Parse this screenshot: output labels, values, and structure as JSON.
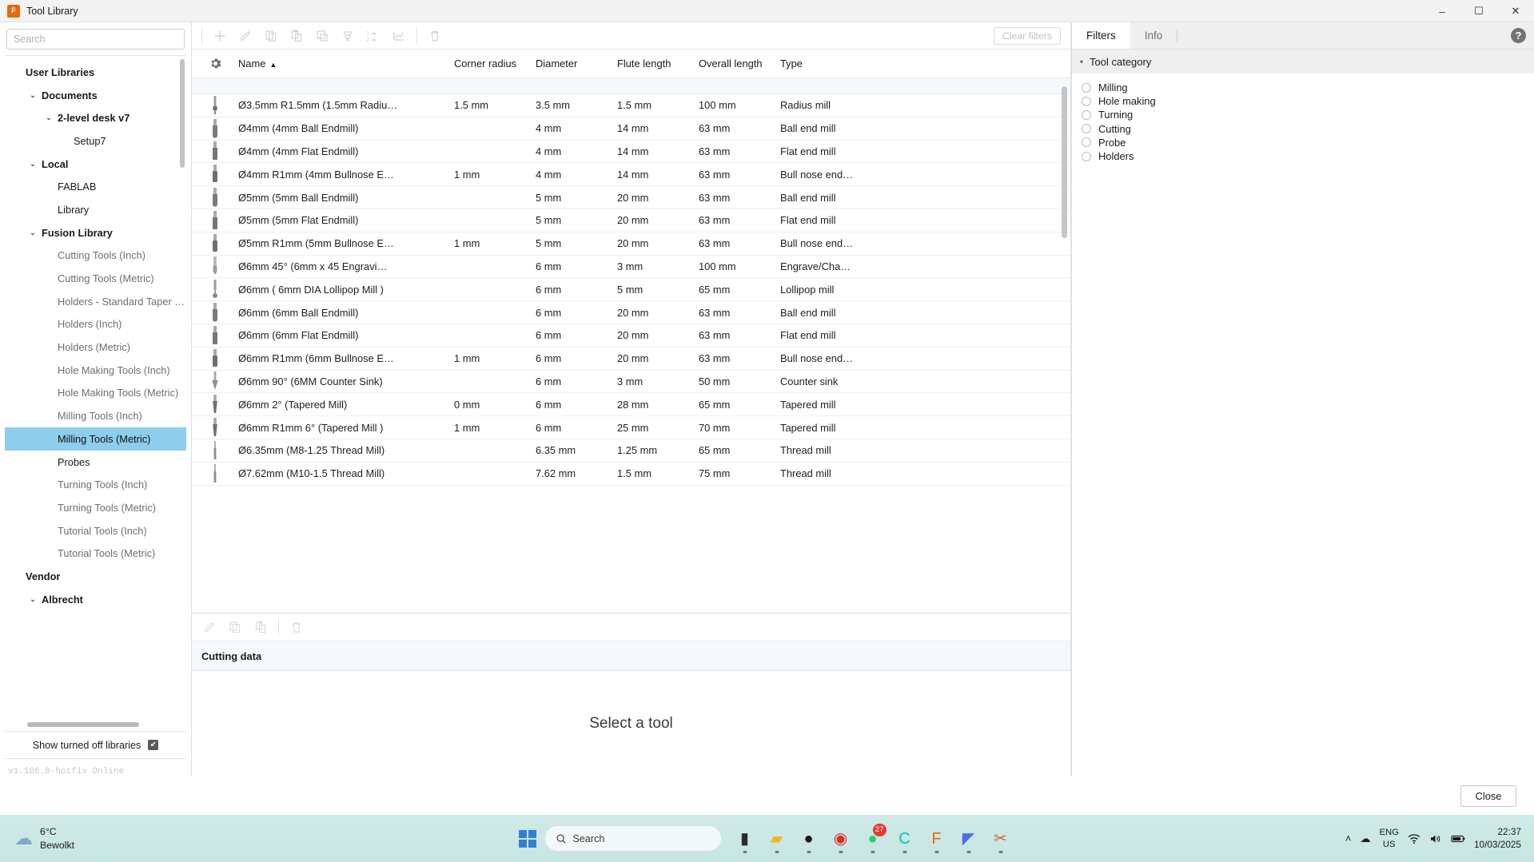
{
  "window": {
    "title": "Tool Library",
    "app_icon": "fusion-icon",
    "minimize": "–",
    "maximize": "☐",
    "close": "✕"
  },
  "sidebar": {
    "search_placeholder": "Search",
    "tree": [
      {
        "label": "User Libraries",
        "indent": 0,
        "style": "group",
        "twisty": ""
      },
      {
        "label": "Documents",
        "indent": 1,
        "style": "bold-item",
        "twisty": "⌄"
      },
      {
        "label": "2-level desk v7",
        "indent": 2,
        "style": "bold-item",
        "twisty": "⌄"
      },
      {
        "label": "Setup7",
        "indent": 3,
        "style": "normal",
        "twisty": ""
      },
      {
        "label": "Local",
        "indent": 1,
        "style": "bold-item",
        "twisty": "⌄"
      },
      {
        "label": "FABLAB",
        "indent": 2,
        "style": "normal",
        "twisty": ""
      },
      {
        "label": "Library",
        "indent": 2,
        "style": "normal",
        "twisty": ""
      },
      {
        "label": "Fusion Library",
        "indent": 1,
        "style": "bold-item",
        "twisty": "⌄"
      },
      {
        "label": "Cutting Tools (Inch)",
        "indent": 2,
        "style": "muted",
        "twisty": ""
      },
      {
        "label": "Cutting Tools (Metric)",
        "indent": 2,
        "style": "muted",
        "twisty": ""
      },
      {
        "label": "Holders - Standard Taper Blank",
        "indent": 2,
        "style": "muted",
        "twisty": ""
      },
      {
        "label": "Holders (Inch)",
        "indent": 2,
        "style": "muted",
        "twisty": ""
      },
      {
        "label": "Holders (Metric)",
        "indent": 2,
        "style": "muted",
        "twisty": ""
      },
      {
        "label": "Hole Making Tools (Inch)",
        "indent": 2,
        "style": "muted",
        "twisty": ""
      },
      {
        "label": "Hole Making Tools (Metric)",
        "indent": 2,
        "style": "muted",
        "twisty": ""
      },
      {
        "label": "Milling Tools (Inch)",
        "indent": 2,
        "style": "muted",
        "twisty": ""
      },
      {
        "label": "Milling Tools (Metric)",
        "indent": 2,
        "style": "selected",
        "twisty": ""
      },
      {
        "label": "Probes",
        "indent": 2,
        "style": "normal",
        "twisty": ""
      },
      {
        "label": "Turning Tools (Inch)",
        "indent": 2,
        "style": "muted",
        "twisty": ""
      },
      {
        "label": "Turning Tools (Metric)",
        "indent": 2,
        "style": "muted",
        "twisty": ""
      },
      {
        "label": "Tutorial Tools (Inch)",
        "indent": 2,
        "style": "muted",
        "twisty": ""
      },
      {
        "label": "Tutorial Tools (Metric)",
        "indent": 2,
        "style": "muted",
        "twisty": ""
      },
      {
        "label": "Vendor",
        "indent": 0,
        "style": "group",
        "twisty": ""
      },
      {
        "label": "Albrecht",
        "indent": 1,
        "style": "bold-item",
        "twisty": "⌄"
      }
    ],
    "show_turned_off_label": "Show turned off libraries",
    "show_turned_off_checked": true,
    "checkmark": "✔",
    "version": "v1.106.8-hotfix Online"
  },
  "toolbar": {
    "buttons": [
      {
        "name": "new-tool-button",
        "icon": "plus-icon"
      },
      {
        "name": "edit-tool-button",
        "icon": "pencil-icon"
      },
      {
        "name": "copy-tool-button",
        "icon": "copy-icon"
      },
      {
        "name": "paste-tool-button",
        "icon": "paste-icon"
      },
      {
        "name": "duplicate-tool-button",
        "icon": "duplicate-icon"
      },
      {
        "name": "holder-button",
        "icon": "holder-icon"
      },
      {
        "name": "renumber-button",
        "icon": "renumber-icon"
      },
      {
        "name": "cutting-data-button",
        "icon": "chart-icon"
      },
      {
        "name": "delete-tool-button",
        "icon": "trash-icon"
      }
    ],
    "clear_filters_label": "Clear filters"
  },
  "table": {
    "gear_icon": "gear-icon",
    "columns": [
      {
        "key": "name",
        "label": "Name",
        "sorted": true,
        "sort_caret": "▲"
      },
      {
        "key": "corner_radius",
        "label": "Corner radius"
      },
      {
        "key": "diameter",
        "label": "Diameter"
      },
      {
        "key": "flute_length",
        "label": "Flute length"
      },
      {
        "key": "overall_length",
        "label": "Overall length"
      },
      {
        "key": "type",
        "label": "Type"
      }
    ],
    "rows": [
      {
        "icon": "radius-mill-icon",
        "name": "Ø3.5mm R1.5mm (1.5mm Radiu…",
        "corner_radius": "1.5 mm",
        "diameter": "3.5 mm",
        "flute_length": "1.5 mm",
        "overall_length": "100 mm",
        "type": "Radius mill"
      },
      {
        "icon": "ball-endmill-icon",
        "name": "Ø4mm (4mm Ball Endmill)",
        "corner_radius": "",
        "diameter": "4 mm",
        "flute_length": "14 mm",
        "overall_length": "63 mm",
        "type": "Ball end mill"
      },
      {
        "icon": "flat-endmill-icon",
        "name": "Ø4mm (4mm Flat Endmill)",
        "corner_radius": "",
        "diameter": "4 mm",
        "flute_length": "14 mm",
        "overall_length": "63 mm",
        "type": "Flat end mill"
      },
      {
        "icon": "bullnose-endmill-icon",
        "name": "Ø4mm R1mm (4mm Bullnose E…",
        "corner_radius": "1 mm",
        "diameter": "4 mm",
        "flute_length": "14 mm",
        "overall_length": "63 mm",
        "type": "Bull nose end…"
      },
      {
        "icon": "ball-endmill-icon",
        "name": "Ø5mm (5mm Ball Endmill)",
        "corner_radius": "",
        "diameter": "5 mm",
        "flute_length": "20 mm",
        "overall_length": "63 mm",
        "type": "Ball end mill"
      },
      {
        "icon": "flat-endmill-icon",
        "name": "Ø5mm (5mm Flat Endmill)",
        "corner_radius": "",
        "diameter": "5 mm",
        "flute_length": "20 mm",
        "overall_length": "63 mm",
        "type": "Flat end mill"
      },
      {
        "icon": "bullnose-endmill-icon",
        "name": "Ø5mm R1mm (5mm Bullnose E…",
        "corner_radius": "1 mm",
        "diameter": "5 mm",
        "flute_length": "20 mm",
        "overall_length": "63 mm",
        "type": "Bull nose end…"
      },
      {
        "icon": "engrave-mill-icon",
        "name": "Ø6mm 45° (6mm x 45 Engravi…",
        "corner_radius": "",
        "diameter": "6 mm",
        "flute_length": "3 mm",
        "overall_length": "100 mm",
        "type": "Engrave/Cha…"
      },
      {
        "icon": "lollipop-mill-icon",
        "name": "Ø6mm ( 6mm DIA Lollipop Mill )",
        "corner_radius": "",
        "diameter": "6 mm",
        "flute_length": "5 mm",
        "overall_length": "65 mm",
        "type": "Lollipop mill"
      },
      {
        "icon": "ball-endmill-icon",
        "name": "Ø6mm (6mm Ball Endmill)",
        "corner_radius": "",
        "diameter": "6 mm",
        "flute_length": "20 mm",
        "overall_length": "63 mm",
        "type": "Ball end mill"
      },
      {
        "icon": "flat-endmill-icon",
        "name": "Ø6mm (6mm Flat Endmill)",
        "corner_radius": "",
        "diameter": "6 mm",
        "flute_length": "20 mm",
        "overall_length": "63 mm",
        "type": "Flat end mill"
      },
      {
        "icon": "bullnose-endmill-icon",
        "name": "Ø6mm R1mm (6mm Bullnose E…",
        "corner_radius": "1 mm",
        "diameter": "6 mm",
        "flute_length": "20 mm",
        "overall_length": "63 mm",
        "type": "Bull nose end…"
      },
      {
        "icon": "counter-sink-icon",
        "name": "Ø6mm 90° (6MM Counter Sink)",
        "corner_radius": "",
        "diameter": "6 mm",
        "flute_length": "3 mm",
        "overall_length": "50 mm",
        "type": "Counter sink"
      },
      {
        "icon": "tapered-mill-icon",
        "name": "Ø6mm 2° (Tapered Mill)",
        "corner_radius": "0 mm",
        "diameter": "6 mm",
        "flute_length": "28 mm",
        "overall_length": "65 mm",
        "type": "Tapered mill"
      },
      {
        "icon": "tapered-mill-icon",
        "name": "Ø6mm R1mm 6° (Tapered Mill )",
        "corner_radius": "1 mm",
        "diameter": "6 mm",
        "flute_length": "25 mm",
        "overall_length": "70 mm",
        "type": "Tapered mill"
      },
      {
        "icon": "thread-mill-icon",
        "name": "Ø6.35mm (M8-1.25 Thread Mill)",
        "corner_radius": "",
        "diameter": "6.35 mm",
        "flute_length": "1.25 mm",
        "overall_length": "65 mm",
        "type": "Thread mill"
      },
      {
        "icon": "thread-mill-icon",
        "name": "Ø7.62mm (M10-1.5 Thread Mill)",
        "corner_radius": "",
        "diameter": "7.62 mm",
        "flute_length": "1.5 mm",
        "overall_length": "75 mm",
        "type": "Thread mill"
      }
    ]
  },
  "bottom_pane": {
    "buttons": [
      {
        "name": "edit-cutting-data-button",
        "icon": "pencil-icon"
      },
      {
        "name": "copy-cutting-data-button",
        "icon": "copy-icon"
      },
      {
        "name": "paste-cutting-data-button",
        "icon": "paste-icon"
      },
      {
        "name": "delete-cutting-data-button",
        "icon": "trash-icon"
      }
    ],
    "tab_label": "Cutting data",
    "empty_message": "Select a tool"
  },
  "right_panel": {
    "tabs": [
      {
        "label": "Filters",
        "active": true
      },
      {
        "label": "Info",
        "active": false
      }
    ],
    "help_icon": "help-icon",
    "help_glyph": "?",
    "section": {
      "caret": "▾",
      "title": "Tool category",
      "options": [
        {
          "label": "Milling",
          "selected": false
        },
        {
          "label": "Hole making",
          "selected": false
        },
        {
          "label": "Turning",
          "selected": false
        },
        {
          "label": "Cutting",
          "selected": false
        },
        {
          "label": "Probe",
          "selected": false
        },
        {
          "label": "Holders",
          "selected": false
        }
      ]
    }
  },
  "footer": {
    "close_label": "Close"
  },
  "taskbar": {
    "weather_temp": "6°C",
    "weather_desc": "Bewolkt",
    "search_placeholder": "Search",
    "search_icon": "search-icon",
    "start_icon": "windows-icon",
    "apps": [
      {
        "name": "taskview-icon",
        "glyph": "▮",
        "color": "#2b2b2b",
        "badge": ""
      },
      {
        "name": "file-explorer-icon",
        "glyph": "▰",
        "color": "#f5b324",
        "badge": ""
      },
      {
        "name": "camera-app-icon",
        "glyph": "●",
        "color": "#1a1a1a",
        "badge": ""
      },
      {
        "name": "chrome-icon",
        "glyph": "◉",
        "color": "#d93025",
        "badge": ""
      },
      {
        "name": "whatsapp-icon",
        "glyph": "●",
        "color": "#25d366",
        "badge": "27"
      },
      {
        "name": "capcut-icon",
        "glyph": "C",
        "color": "#00c7b7",
        "badge": ""
      },
      {
        "name": "fusion-360-icon",
        "glyph": "F",
        "color": "#e8690b",
        "badge": ""
      },
      {
        "name": "photos-icon",
        "glyph": "◤",
        "color": "#4f6bed",
        "badge": ""
      },
      {
        "name": "snipping-tool-icon",
        "glyph": "✂",
        "color": "#e05a2b",
        "badge": ""
      }
    ],
    "chevron_up": "˄",
    "cloud_icon": "cloud-icon",
    "lang_line1": "ENG",
    "lang_line2": "US",
    "wifi_icon": "wifi-icon",
    "volume_icon": "volume-icon",
    "battery_icon": "battery-icon",
    "time": "22:37",
    "date": "10/03/2025"
  }
}
